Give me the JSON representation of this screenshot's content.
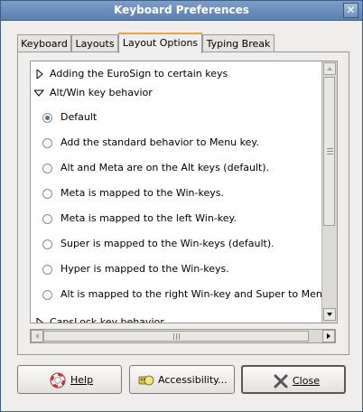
{
  "window": {
    "title": "Keyboard Preferences",
    "close_glyph": "✕"
  },
  "tabs": [
    {
      "label": "Keyboard",
      "active": false
    },
    {
      "label": "Layouts",
      "active": false
    },
    {
      "label": "Layout Options",
      "active": true
    },
    {
      "label": "Typing Break",
      "active": false
    }
  ],
  "options_tree": {
    "groups": [
      {
        "label": "Adding the EuroSign to certain keys",
        "expanded": false
      },
      {
        "label": "Alt/Win key behavior",
        "expanded": true,
        "options": [
          {
            "label": "Default",
            "selected": true
          },
          {
            "label": "Add the standard behavior to Menu key.",
            "selected": false
          },
          {
            "label": "Alt and Meta are on the Alt keys (default).",
            "selected": false
          },
          {
            "label": "Meta is mapped to the Win-keys.",
            "selected": false
          },
          {
            "label": "Meta is mapped to the left Win-key.",
            "selected": false
          },
          {
            "label": "Super is mapped to the Win-keys (default).",
            "selected": false
          },
          {
            "label": "Hyper is mapped to the Win-keys.",
            "selected": false
          },
          {
            "label": "Alt is mapped to the right Win-key and Super to Menu.",
            "selected": false
          }
        ]
      },
      {
        "label": "CapsLock key behavior",
        "expanded": false
      }
    ]
  },
  "buttons": {
    "help": {
      "label": "Help",
      "icon": "lifebuoy-icon"
    },
    "accessibility": {
      "label": "Accessibility...",
      "icon": "accessibility-icon"
    },
    "close": {
      "label": "Close",
      "icon": "close-x-icon"
    }
  },
  "colors": {
    "titlebar": "#6b8fbd",
    "active_tab_accent": "#e8a23f",
    "radio_selected": "#4b6fa1"
  }
}
